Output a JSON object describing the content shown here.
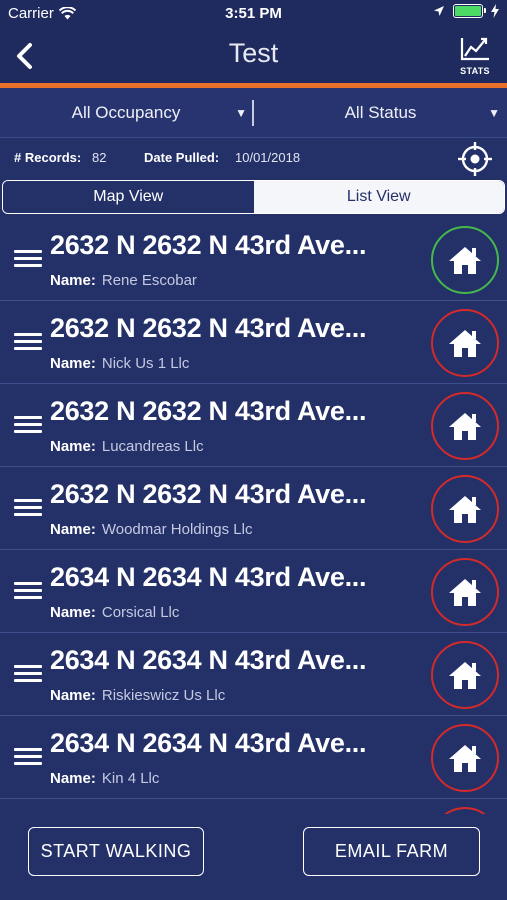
{
  "status_bar": {
    "carrier": "Carrier",
    "time": "3:51 PM",
    "battery_color": "#4cd964"
  },
  "nav": {
    "title": "Test",
    "back_icon": "chevron-left-icon",
    "stats_label": "STATS",
    "accent_color": "#e8702a"
  },
  "filters": {
    "occupancy": "All Occupancy",
    "status": "All Status"
  },
  "records": {
    "count_label": "# Records:",
    "count_value": "82",
    "date_label": "Date Pulled:",
    "date_value": "10/01/2018"
  },
  "view_toggle": {
    "map": "Map View",
    "list": "List View",
    "selected": "List View"
  },
  "list": {
    "name_label": "Name:",
    "items": [
      {
        "address": "2632 N 2632 N 43rd Ave...",
        "name": "Rene Escobar",
        "status_color": "green"
      },
      {
        "address": "2632 N 2632 N 43rd Ave...",
        "name": "Nick Us 1 Llc",
        "status_color": "red"
      },
      {
        "address": "2632 N 2632 N 43rd Ave...",
        "name": "Lucandreas Llc",
        "status_color": "red"
      },
      {
        "address": "2632 N 2632 N 43rd Ave...",
        "name": "Woodmar Holdings Llc",
        "status_color": "red"
      },
      {
        "address": "2634 N 2634 N 43rd Ave...",
        "name": "Corsical Llc",
        "status_color": "red"
      },
      {
        "address": "2634 N 2634 N 43rd Ave...",
        "name": "Riskieswicz Us Llc",
        "status_color": "red"
      },
      {
        "address": "2634 N 2634 N 43rd Ave...",
        "name": "Kin 4 Llc",
        "status_color": "red"
      }
    ]
  },
  "actions": {
    "start_walking": "START WALKING",
    "email_farm": "EMAIL FARM"
  }
}
